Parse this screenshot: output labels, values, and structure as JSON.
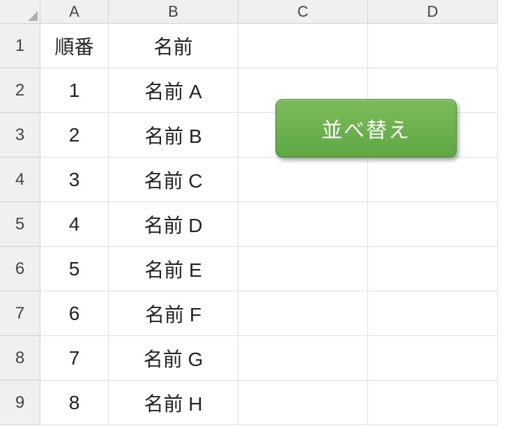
{
  "columns": [
    "A",
    "B",
    "C",
    "D"
  ],
  "rows": [
    "1",
    "2",
    "3",
    "4",
    "5",
    "6",
    "7",
    "8",
    "9"
  ],
  "headers": {
    "col_a": "順番",
    "col_b": "名前"
  },
  "data": [
    {
      "num": "1",
      "name": "名前 A"
    },
    {
      "num": "2",
      "name": "名前 B"
    },
    {
      "num": "3",
      "name": "名前 C"
    },
    {
      "num": "4",
      "name": "名前 D"
    },
    {
      "num": "5",
      "name": "名前 E"
    },
    {
      "num": "6",
      "name": "名前 F"
    },
    {
      "num": "7",
      "name": "名前 G"
    },
    {
      "num": "8",
      "name": "名前 H"
    }
  ],
  "button": {
    "sort_label": "並べ替え"
  }
}
